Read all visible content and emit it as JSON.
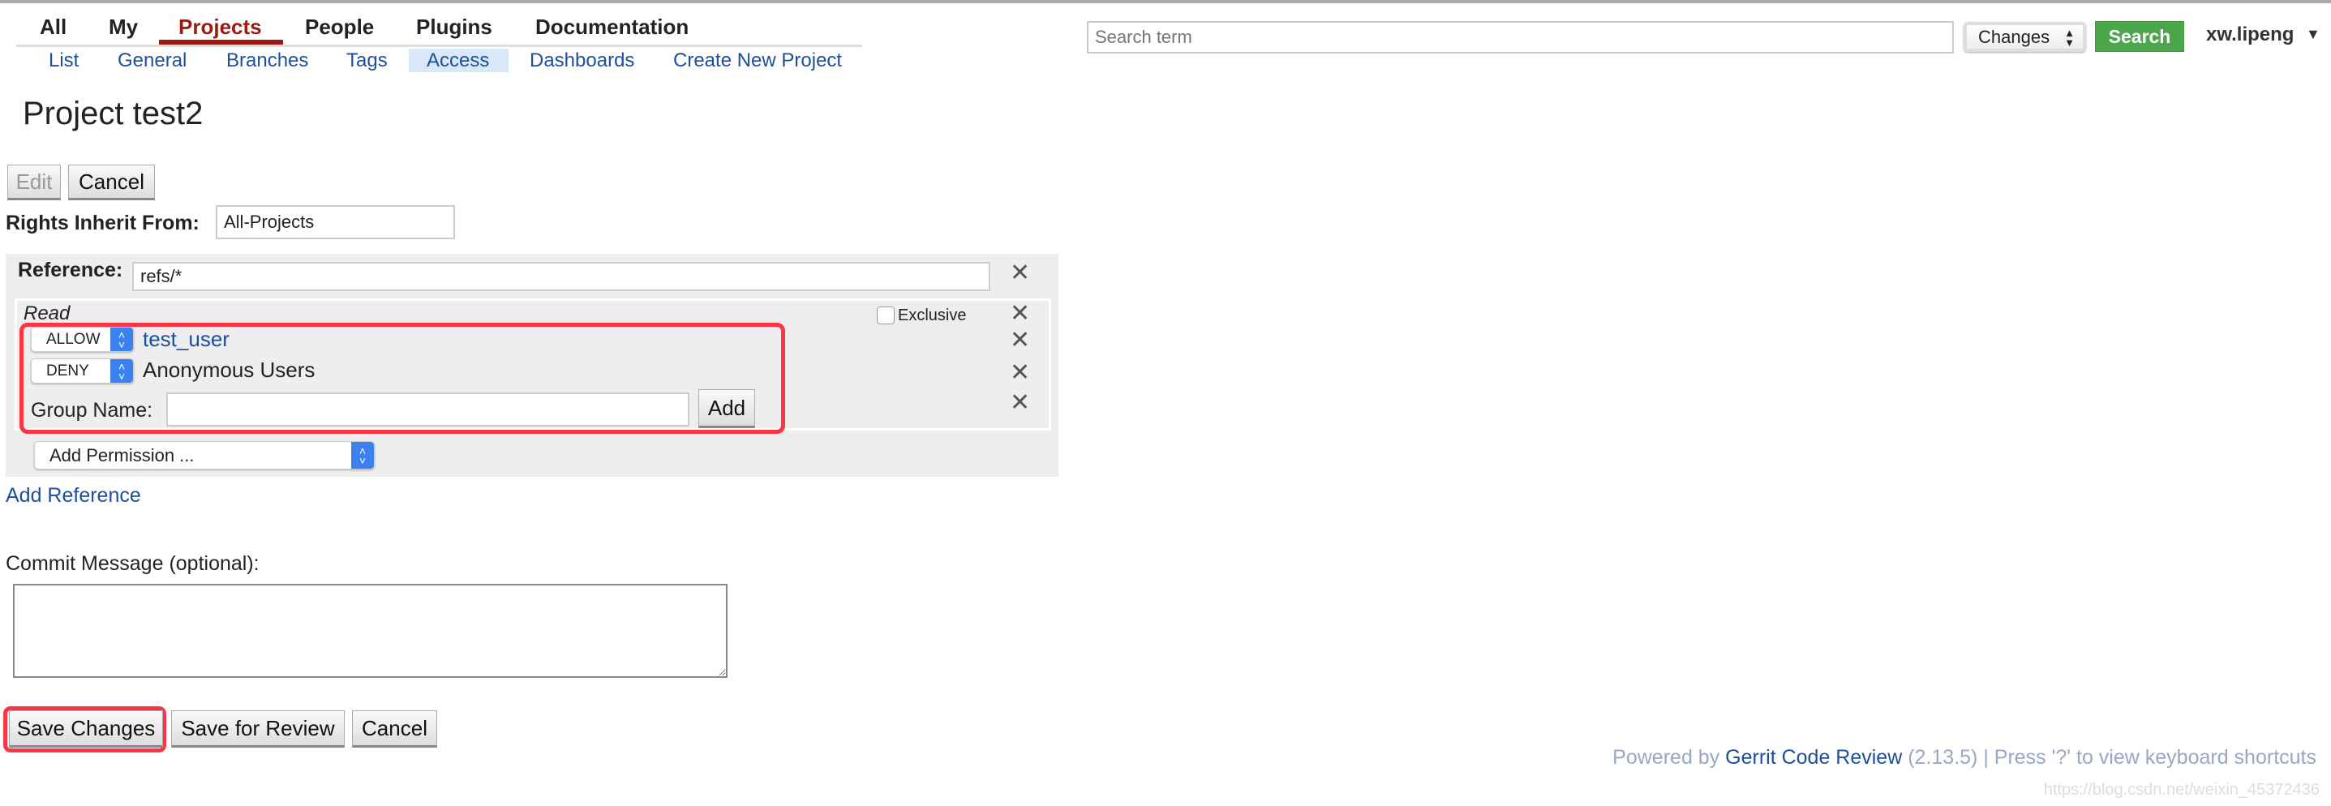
{
  "nav": {
    "items": [
      "All",
      "My",
      "Projects",
      "People",
      "Plugins",
      "Documentation"
    ],
    "active": "Projects"
  },
  "subnav": {
    "items": [
      "List",
      "General",
      "Branches",
      "Tags",
      "Access",
      "Dashboards",
      "Create New Project"
    ],
    "active": "Access"
  },
  "search": {
    "placeholder": "Search term",
    "value": "",
    "scope": "Changes",
    "button": "Search"
  },
  "user": {
    "name": "xw.lipeng"
  },
  "page": {
    "title": "Project test2"
  },
  "actions": {
    "edit": "Edit",
    "cancel": "Cancel"
  },
  "inherit": {
    "label": "Rights Inherit From:",
    "value": "All-Projects"
  },
  "reference": {
    "label": "Reference:",
    "value": "refs/*",
    "permission": {
      "name": "Read",
      "exclusive_label": "Exclusive",
      "exclusive": false,
      "rules": [
        {
          "action": "ALLOW",
          "group": "test_user"
        },
        {
          "action": "DENY",
          "group": "Anonymous Users"
        }
      ],
      "group_name_label": "Group Name:",
      "group_name_value": "",
      "add_button": "Add"
    },
    "add_permission": "Add Permission ..."
  },
  "add_reference": "Add Reference",
  "commit": {
    "label": "Commit Message (optional):",
    "value": ""
  },
  "footer_buttons": {
    "save": "Save Changes",
    "review": "Save for Review",
    "cancel": "Cancel"
  },
  "footer": {
    "prefix": "Powered by ",
    "link": "Gerrit Code Review",
    "suffix": " (2.13.5) | Press '?' to view keyboard shortcuts"
  },
  "watermark": "https://blog.csdn.net/weixin_45372436",
  "colors": {
    "accent": "#9b1b12",
    "link": "#1c4fa0",
    "search_button": "#4ca64c",
    "highlight": "#ff3344"
  }
}
